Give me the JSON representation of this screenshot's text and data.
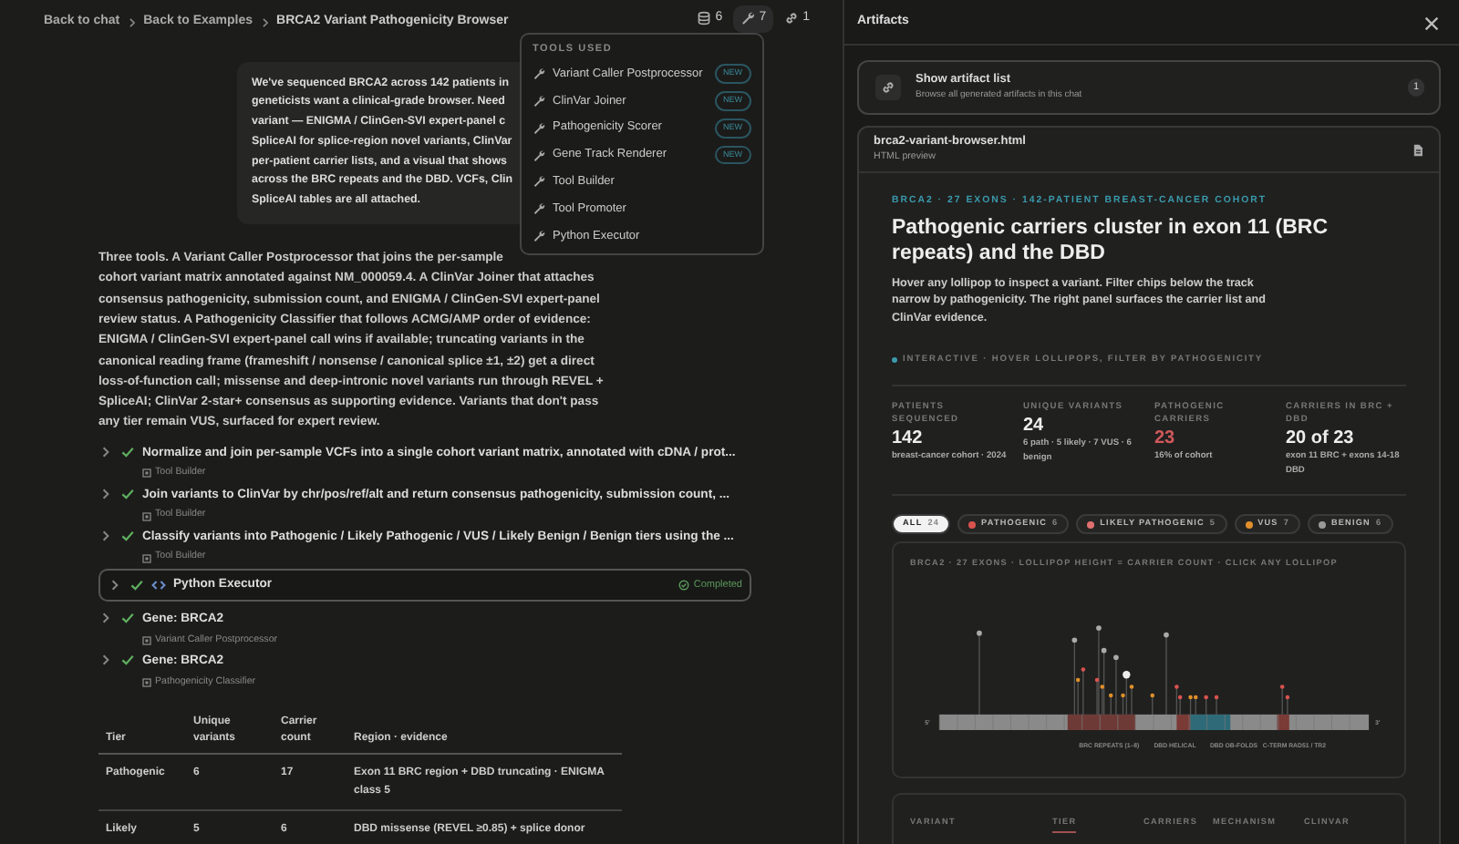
{
  "breadcrumb": [
    "Back to chat",
    "Back to Examples",
    "BRCA2 Variant Pathogenicity Browser"
  ],
  "header_counters": [
    {
      "kind": "files",
      "count": "6",
      "selected": false
    },
    {
      "kind": "tools",
      "count": "7",
      "selected": true
    },
    {
      "kind": "artifacts",
      "count": "1",
      "selected": false
    }
  ],
  "tools_menu": {
    "title": "TOOLS USED",
    "items": [
      {
        "name": "Variant Caller Postprocessor",
        "badge": "NEW"
      },
      {
        "name": "ClinVar Joiner",
        "badge": "NEW"
      },
      {
        "name": "Pathogenicity Scorer",
        "badge": "NEW"
      },
      {
        "name": "Gene Track Renderer",
        "badge": "NEW"
      },
      {
        "name": "Tool Builder"
      },
      {
        "name": "Tool Promoter"
      },
      {
        "name": "Python Executor"
      }
    ]
  },
  "user_message_lines": [
    "We've sequenced BRCA2 across 142 patients in",
    "geneticists want a clinical-grade browser. Need",
    "variant — ENIGMA / ClinGen-SVI expert-panel c",
    "SpliceAI for splice-region novel variants, ClinVar",
    "per-patient carrier lists, and a visual that shows",
    "across the BRC repeats and the DBD. VCFs, Clin",
    "SpliceAI tables are all attached."
  ],
  "reply_lines": [
    "Three tools. A Variant Caller Postprocessor that joins the per-sample",
    "cohort variant matrix annotated against NM_000059.4. A ClinVar Joiner that attaches",
    "consensus pathogenicity, submission count, and ENIGMA / ClinGen-SVI expert-panel",
    "review status. A Pathogenicity Classifier that follows ACMG/AMP order of evidence:",
    "ENIGMA / ClinGen-SVI expert-panel call wins if available; truncating variants in the",
    "canonical reading frame (frameshift / nonsense / canonical splice ±1, ±2) get a direct",
    "loss-of-function call; missense and deep-intronic novel variants run through REVEL +",
    "SpliceAI; ClinVar 2-star+ consensus as supporting evidence. Variants that don't pass",
    "any tier remain VUS, surfaced for expert review."
  ],
  "steps": [
    {
      "kind": "step",
      "done": true,
      "title": "Normalize and join per-sample VCFs into a single cohort variant matrix, annotated with cDNA / prot...",
      "tool": "Tool Builder"
    },
    {
      "kind": "step",
      "done": true,
      "title": "Join variants to ClinVar by chr/pos/ref/alt and return consensus pathogenicity, submission count, ...",
      "tool": "Tool Builder"
    },
    {
      "kind": "step",
      "done": true,
      "title": "Classify variants into Pathogenic / Likely Pathogenic / VUS / Likely Benign / Benign tiers using the ...",
      "tool": "Tool Builder"
    },
    {
      "kind": "executor",
      "done": true,
      "title": "Python Executor",
      "status": "Completed"
    },
    {
      "kind": "step",
      "done": true,
      "title": "Gene: BRCA2",
      "tool": "Variant Caller Postprocessor"
    },
    {
      "kind": "step",
      "done": true,
      "title": "Gene: BRCA2",
      "tool": "Pathogenicity Classifier"
    }
  ],
  "summary_table": {
    "columns": [
      "Tier",
      "Unique variants",
      "Carrier count",
      "Region · evidence"
    ],
    "rows": [
      [
        "Pathogenic",
        "6",
        "17",
        "Exon 11 BRC region + DBD truncating · ENIGMA class 5"
      ],
      [
        "Likely",
        "5",
        "6",
        "DBD missense (REVEL ≥0.85) + splice donor"
      ]
    ]
  },
  "artifacts_panel": {
    "title": "Artifacts",
    "list_button": {
      "title": "Show artifact list",
      "subtitle": "Browse all generated artifacts in this chat",
      "count": "1"
    },
    "artifact": {
      "filename": "brca2-variant-browser.html",
      "type": "HTML preview",
      "eyebrow": "BRCA2 · 27 EXONS · 142-PATIENT BREAST-CANCER COHORT",
      "heading": "Pathogenic carriers cluster in exon 11 (BRC repeats) and the DBD",
      "description": "Hover any lollipop to inspect a variant. Filter chips below the track narrow by pathogenicity. The right panel surfaces the carrier list and ClinVar evidence.",
      "hint": "INTERACTIVE · HOVER LOLLIPOPS, FILTER BY PATHOGENICITY",
      "stats": [
        {
          "label": "PATIENTS SEQUENCED",
          "value": "142",
          "note": "breast-cancer cohort · 2024",
          "highlight": false
        },
        {
          "label": "UNIQUE VARIANTS",
          "value": "24",
          "note": "6 path · 5 likely · 7 VUS · 6 benign",
          "highlight": false
        },
        {
          "label": "PATHOGENIC CARRIERS",
          "value": "23",
          "note": "16% of cohort",
          "highlight": true
        },
        {
          "label": "CARRIERS IN BRC + DBD",
          "value": "20 of 23",
          "note": "exon 11 BRC + exons 14-18 DBD",
          "highlight": false
        }
      ],
      "filters": [
        {
          "label": "ALL",
          "count": "24",
          "selected": true
        },
        {
          "label": "PATHOGENIC",
          "count": "6",
          "selected": false,
          "color": "#d9534f"
        },
        {
          "label": "LIKELY PATHOGENIC",
          "count": "5",
          "selected": false,
          "color": "#e07070"
        },
        {
          "label": "VUS",
          "count": "7",
          "selected": false,
          "color": "#e0902a"
        },
        {
          "label": "BENIGN",
          "count": "6",
          "selected": false,
          "color": "#9a9a9a"
        }
      ],
      "track": {
        "title": "BRCA2 · 27 EXONS · LOLLIPOP HEIGHT = CARRIER COUNT · CLICK ANY LOLLIPOP",
        "five_prime": "5′",
        "three_prime": "3′",
        "domains": [
          "BRC REPEATS (1–8)",
          "DBD HELICAL",
          "DBD OB-FOLDS",
          "C-TERM RAD51 / TR2"
        ]
      },
      "variant_table": {
        "columns": [
          {
            "label": "VARIANT",
            "sorted": false
          },
          {
            "label": "TIER",
            "sorted": true
          },
          {
            "label": "CARRIERS",
            "sorted": false
          },
          {
            "label": "MECHANISM",
            "sorted": false
          },
          {
            "label": "CLINVAR",
            "sorted": false
          }
        ]
      }
    }
  }
}
